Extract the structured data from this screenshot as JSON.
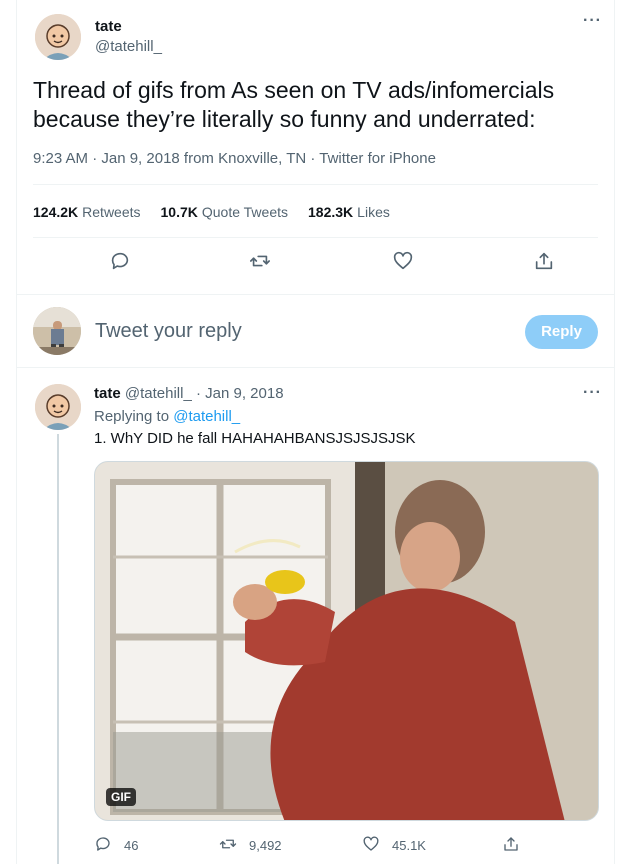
{
  "tweet": {
    "author_name": "tate",
    "author_handle": "@tatehill_",
    "text": "Thread of gifs from As seen on TV ads/infomercials because they’re literally so funny and underrated:",
    "meta": "9:23 AM · Jan 9, 2018 from Knoxville, TN · Twitter for iPhone",
    "retweets_count": "124.2K",
    "retweets_label": "Retweets",
    "quotes_count": "10.7K",
    "quotes_label": "Quote Tweets",
    "likes_count": "182.3K",
    "likes_label": "Likes",
    "more_label": "···"
  },
  "composer": {
    "placeholder": "Tweet your reply",
    "button_label": "Reply"
  },
  "reply": {
    "author_name": "tate",
    "author_handle": "@tatehill_",
    "date": "· Jan 9, 2018",
    "replying_prefix": "Replying to",
    "replying_to": "@tatehill_",
    "text": "1. WhY DID he fall HAHAHAHBANSJSJSJSJSK",
    "media_badge": "GIF",
    "reply_count": "46",
    "retweet_count": "9,492",
    "like_count": "45.1K",
    "more_label": "···"
  },
  "icons": {
    "reply": "reply-icon",
    "retweet": "retweet-icon",
    "like": "heart-icon",
    "share": "share-icon",
    "more": "more-icon"
  },
  "colors": {
    "accent": "#1d9bf0",
    "reply_button_disabled": "#8ecdf8",
    "secondary_text": "#536471"
  }
}
